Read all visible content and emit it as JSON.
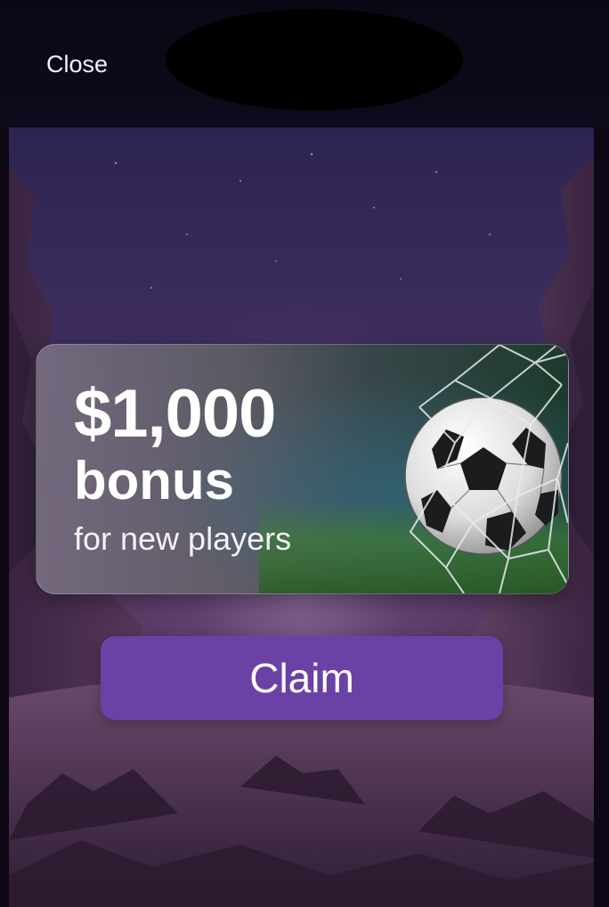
{
  "header": {
    "close_label": "Close"
  },
  "promo": {
    "amount": "$1,000",
    "bonus_label": "bonus",
    "subtitle": "for new players",
    "image_icon": "soccer-ball-in-net"
  },
  "actions": {
    "claim_label": "Claim"
  },
  "colors": {
    "accent": "#6a42a6",
    "top_bar": "#0d0716",
    "text": "#ffffff"
  }
}
